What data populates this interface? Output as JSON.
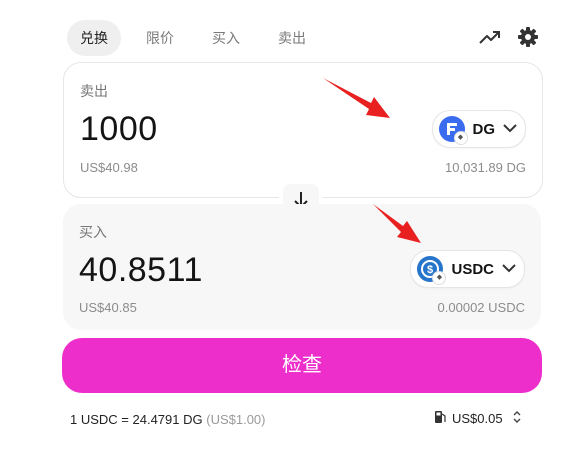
{
  "tabs": [
    {
      "label": "兑换",
      "active": true
    },
    {
      "label": "限价",
      "active": false
    },
    {
      "label": "买入",
      "active": false
    },
    {
      "label": "卖出",
      "active": false
    }
  ],
  "sell": {
    "label": "卖出",
    "amount": "1000",
    "usd_value": "US$40.98",
    "balance": "10,031.89 DG",
    "token": {
      "symbol": "DG",
      "color": "#3b6cf0"
    }
  },
  "buy": {
    "label": "买入",
    "amount": "40.8511",
    "usd_value": "US$40.85",
    "balance": "0.00002 USDC",
    "token": {
      "symbol": "USDC",
      "color": "#2775ca"
    }
  },
  "review_button": {
    "label": "检查",
    "color": "#ee2ecb"
  },
  "rate": {
    "text": "1 USDC = 24.4791 DG",
    "usd": "(US$1.00)"
  },
  "gas": {
    "fee": "US$0.05"
  },
  "icons": [
    "chart-trend-icon",
    "gear-icon",
    "swap-arrow-down-icon",
    "gas-pump-icon",
    "chevron-updown-icon"
  ],
  "annotation_color": "#e8201f"
}
